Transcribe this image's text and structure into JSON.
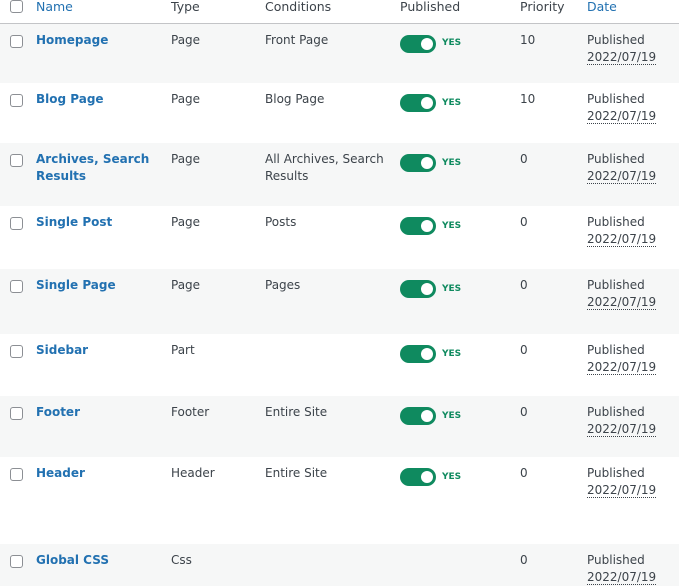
{
  "columns": {
    "name": "Name",
    "type": "Type",
    "conditions": "Conditions",
    "published": "Published",
    "priority": "Priority",
    "date": "Date"
  },
  "colors": {
    "link": "#2271b1",
    "toggle_on": "#0f8a5f",
    "row_alt": "#f6f7f7"
  },
  "rows": [
    {
      "name": "Homepage",
      "type": "Page",
      "conditions": "Front Page",
      "published": true,
      "published_label": "YES",
      "priority": "10",
      "date_status": "Published",
      "date": "2022/07/19"
    },
    {
      "name": "Blog Page",
      "type": "Page",
      "conditions": "Blog Page",
      "published": true,
      "published_label": "YES",
      "priority": "10",
      "date_status": "Published",
      "date": "2022/07/19"
    },
    {
      "name": "Archives, Search Results",
      "type": "Page",
      "conditions": "All Archives, Search Results",
      "published": true,
      "published_label": "YES",
      "priority": "0",
      "date_status": "Published",
      "date": "2022/07/19"
    },
    {
      "name": "Single Post",
      "type": "Page",
      "conditions": "Posts",
      "published": true,
      "published_label": "YES",
      "priority": "0",
      "date_status": "Published",
      "date": "2022/07/19"
    },
    {
      "name": "Single Page",
      "type": "Page",
      "conditions": "Pages",
      "published": true,
      "published_label": "YES",
      "priority": "0",
      "date_status": "Published",
      "date": "2022/07/19"
    },
    {
      "name": "Sidebar",
      "type": "Part",
      "conditions": "",
      "published": true,
      "published_label": "YES",
      "priority": "0",
      "date_status": "Published",
      "date": "2022/07/19"
    },
    {
      "name": "Footer",
      "type": "Footer",
      "conditions": "Entire Site",
      "published": true,
      "published_label": "YES",
      "priority": "0",
      "date_status": "Published",
      "date": "2022/07/19"
    },
    {
      "name": "Header",
      "type": "Header",
      "conditions": "Entire Site",
      "published": true,
      "published_label": "YES",
      "priority": "0",
      "date_status": "Published",
      "date": "2022/07/19"
    },
    {
      "name": "Global CSS",
      "type": "Css",
      "conditions": "",
      "published": false,
      "published_label": "",
      "priority": "0",
      "date_status": "Published",
      "date": "2022/07/19"
    }
  ]
}
